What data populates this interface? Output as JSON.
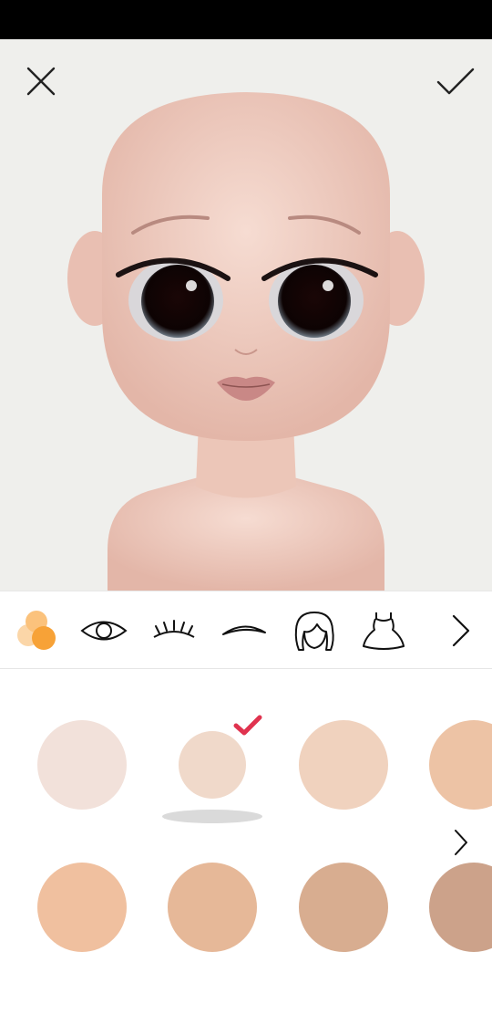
{
  "header": {
    "close_icon": "close-x-icon",
    "confirm_icon": "checkmark-icon"
  },
  "categories": [
    {
      "name": "skin-tone",
      "icon": "palette-dots-icon",
      "selected": true
    },
    {
      "name": "eyes",
      "icon": "eye-icon"
    },
    {
      "name": "eyelashes",
      "icon": "eyelash-icon"
    },
    {
      "name": "eyebrows",
      "icon": "eyebrow-icon"
    },
    {
      "name": "hair",
      "icon": "hair-icon"
    },
    {
      "name": "outfit",
      "icon": "dress-icon"
    },
    {
      "name": "more",
      "icon": "chevron-right-icon"
    }
  ],
  "skin_swatches": {
    "selected_index": 1,
    "colors": [
      "#f2e1da",
      "#f0d9ca",
      "#f0d2be",
      "#edc3a5",
      "#f0c09f",
      "#e6b898",
      "#d8ad90",
      "#cca28a"
    ]
  },
  "accent_colors": {
    "check": "#e0334f",
    "palette_orange": "#f7a237",
    "palette_light": "#fbd6a8"
  }
}
